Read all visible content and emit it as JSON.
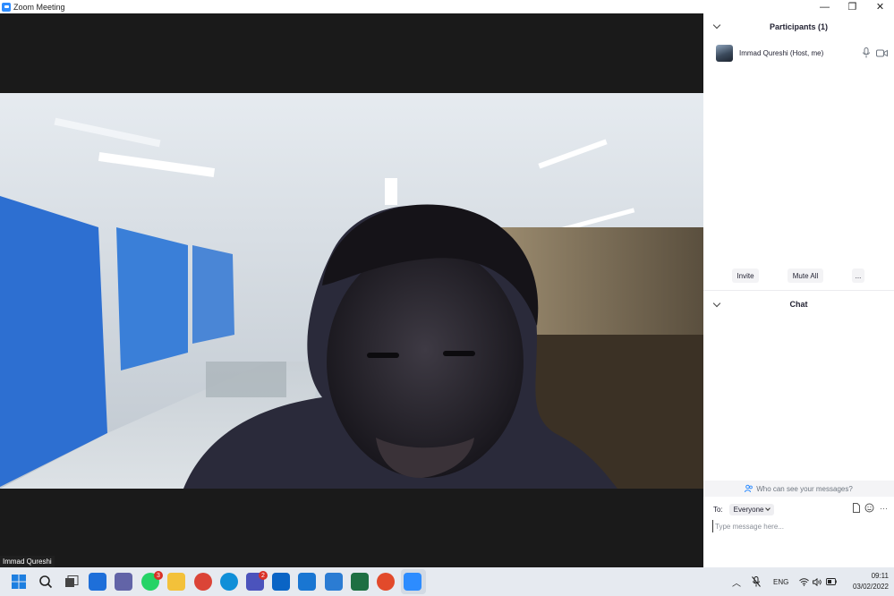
{
  "window": {
    "title": "Zoom Meeting",
    "controls": {
      "minimize": "—",
      "restore": "❐",
      "close": "✕"
    }
  },
  "video": {
    "participant_name_tag": "Immad Qureshi"
  },
  "participants_panel": {
    "title": "Participants (1)",
    "participants": [
      {
        "name": "Immad Qureshi (Host, me)",
        "icons": [
          "microphone-icon",
          "video-camera-icon"
        ]
      }
    ],
    "buttons": {
      "invite": "Invite",
      "mute_all": "Mute All",
      "more": "..."
    }
  },
  "chat_panel": {
    "title": "Chat",
    "who_can_see": "Who can see your messages?",
    "to_label": "To:",
    "recipient": "Everyone",
    "input_placeholder": "Type message here...",
    "tool_icons": [
      "file-icon",
      "emoji-icon",
      "more-icon"
    ],
    "more_label": "···"
  },
  "taskbar": {
    "apps": [
      {
        "name": "start",
        "color": "#1e7fe0"
      },
      {
        "name": "search",
        "color": "#ffffff"
      },
      {
        "name": "task-view",
        "color": "#ffffff"
      },
      {
        "name": "widgets",
        "color": "#1e6fd9"
      },
      {
        "name": "teams-chat",
        "color": "#6264a7"
      },
      {
        "name": "whatsapp",
        "color": "#25d366",
        "badge": "3"
      },
      {
        "name": "file-explorer",
        "color": "#f3c13a"
      },
      {
        "name": "chrome",
        "color": "#db4437"
      },
      {
        "name": "edge",
        "color": "#0f8fd8"
      },
      {
        "name": "teams",
        "color": "#4b53bc",
        "badge": "2"
      },
      {
        "name": "outlook",
        "color": "#0a64c5"
      },
      {
        "name": "mail",
        "color": "#1976d2"
      },
      {
        "name": "store",
        "color": "#2b7cd3"
      },
      {
        "name": "excel",
        "color": "#1d6f42"
      },
      {
        "name": "app-red",
        "color": "#e24a2b"
      },
      {
        "name": "zoom",
        "color": "#2d8cff"
      }
    ],
    "tray": {
      "language": "ENG",
      "time": "09:11",
      "date": "03/02/2022"
    }
  },
  "colors": {
    "zoom_blue": "#2d8cff",
    "background": "#1a1a1a",
    "panel": "#ffffff"
  }
}
